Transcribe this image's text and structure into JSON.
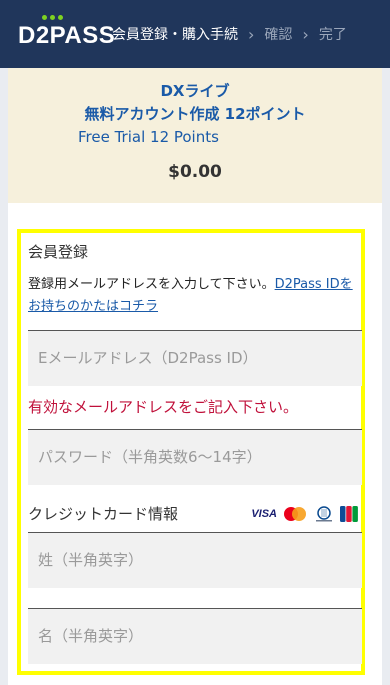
{
  "header": {
    "logo_text": "D2PASS",
    "steps": [
      "会員登録・購入手続",
      "確認",
      "完了"
    ]
  },
  "summary": {
    "product_line1": "DXライブ",
    "product_line2": "無料アカウント作成 12ポイント",
    "product_line3": "Free Trial 12 Points",
    "price": "$0.00"
  },
  "form": {
    "section_title": "会員登録",
    "note_text": "登録用メールアドレスを入力して下さい。",
    "note_link": "D2Pass IDをお持ちのかたはコチラ",
    "email_placeholder": "Eメールアドレス（D2Pass ID）",
    "email_error": "有効なメールアドレスをご記入下さい。",
    "password_placeholder": "パスワード（半角英数6〜14字）",
    "cc_title": "クレジットカード情報",
    "cards": [
      "VISA",
      "Mastercard",
      "Diners Club",
      "JCB"
    ],
    "last_name_placeholder": "姓（半角英字）",
    "first_name_placeholder": "名（半角英字）"
  },
  "colors": {
    "header_bg": "#20365b",
    "summary_bg": "#f6f0dc",
    "link": "#1a5aa8",
    "error": "#c0103a",
    "highlight": "#ffff00"
  }
}
